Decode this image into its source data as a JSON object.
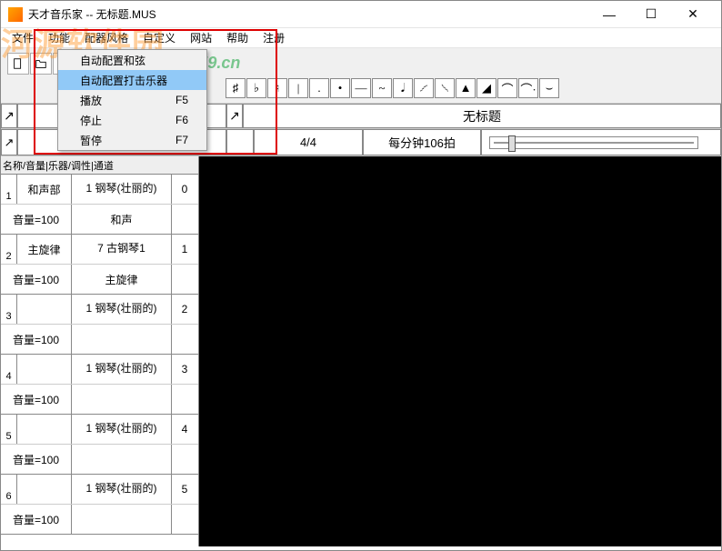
{
  "window": {
    "title": "天才音乐家 -- 无标题.MUS",
    "minimize": "—",
    "maximize": "☐",
    "close": "✕"
  },
  "watermark": {
    "site_name": "河源软件园",
    "url": "www.pc0359.cn"
  },
  "menubar": {
    "items": [
      "文件",
      "功能",
      "配器风格",
      "自定义",
      "网站",
      "帮助",
      "注册"
    ]
  },
  "dropdown": {
    "items": [
      {
        "label": "自动配置和弦",
        "shortcut": ""
      },
      {
        "label": "自动配置打击乐器",
        "shortcut": "",
        "highlighted": true
      },
      {
        "label": "播放",
        "shortcut": "F5"
      },
      {
        "label": "停止",
        "shortcut": "F6"
      },
      {
        "label": "暂停",
        "shortcut": "F7"
      }
    ]
  },
  "toolbar2_symbols": [
    "♯",
    "♭",
    "♮",
    "|",
    ".",
    "•",
    "—",
    "~",
    "𝅘𝅥",
    "𝆱",
    "𝆲",
    "▲",
    "◢",
    "⌒",
    "⌒·",
    "⌣"
  ],
  "song": {
    "title": "无标题",
    "time_sig": "4/4",
    "tempo": "每分钟106拍"
  },
  "left_header": "名称/音量|乐器/调性|通道",
  "tracks": [
    {
      "num": "1",
      "name": "和声部",
      "instr": "1 钢琴(壮丽的)",
      "ch": "0",
      "vol": "音量=100",
      "mode": "和声"
    },
    {
      "num": "2",
      "name": "主旋律",
      "instr": "7 古钢琴1",
      "ch": "1",
      "vol": "音量=100",
      "mode": "主旋律"
    },
    {
      "num": "3",
      "name": "",
      "instr": "1 钢琴(壮丽的)",
      "ch": "2",
      "vol": "音量=100",
      "mode": ""
    },
    {
      "num": "4",
      "name": "",
      "instr": "1 钢琴(壮丽的)",
      "ch": "3",
      "vol": "音量=100",
      "mode": ""
    },
    {
      "num": "5",
      "name": "",
      "instr": "1 钢琴(壮丽的)",
      "ch": "4",
      "vol": "音量=100",
      "mode": ""
    },
    {
      "num": "6",
      "name": "",
      "instr": "1 钢琴(壮丽的)",
      "ch": "5",
      "vol": "音量=100",
      "mode": ""
    }
  ]
}
